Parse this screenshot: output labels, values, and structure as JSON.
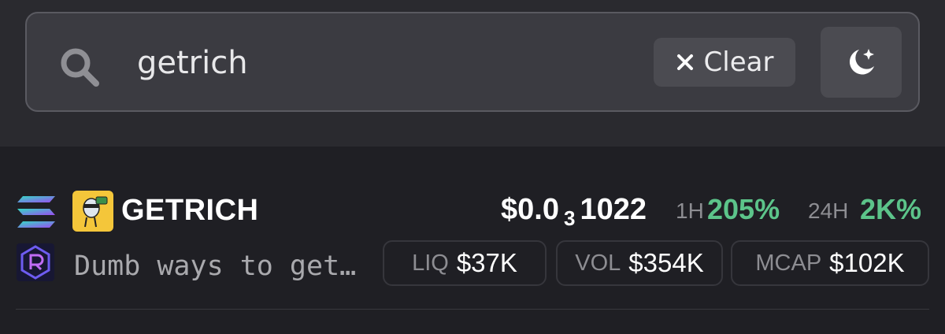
{
  "search": {
    "value": "getrich",
    "clear_label": "Clear"
  },
  "icons": {
    "search": "search-icon",
    "clear": "close-icon",
    "theme": "moon-star-icon",
    "chain": "solana-icon",
    "dex": "raydium-icon"
  },
  "result": {
    "symbol": "GETRICH",
    "description": "Dumb ways to get…",
    "price": {
      "prefix": "$0.0",
      "zero_count": "3",
      "digits": "1022"
    },
    "change_1h": {
      "label": "1H",
      "value": "205%"
    },
    "change_24h": {
      "label": "24H",
      "value": "2K%"
    },
    "stats": [
      {
        "label": "LIQ",
        "value": "$37K"
      },
      {
        "label": "VOL",
        "value": "$354K"
      },
      {
        "label": "MCAP",
        "value": "$102K"
      }
    ]
  },
  "colors": {
    "background": "#1f1f24",
    "header_band": "#2a2a2f",
    "search_field": "#3b3b41",
    "positive": "#5cc48a",
    "token_avatar": "#f4c63a"
  }
}
